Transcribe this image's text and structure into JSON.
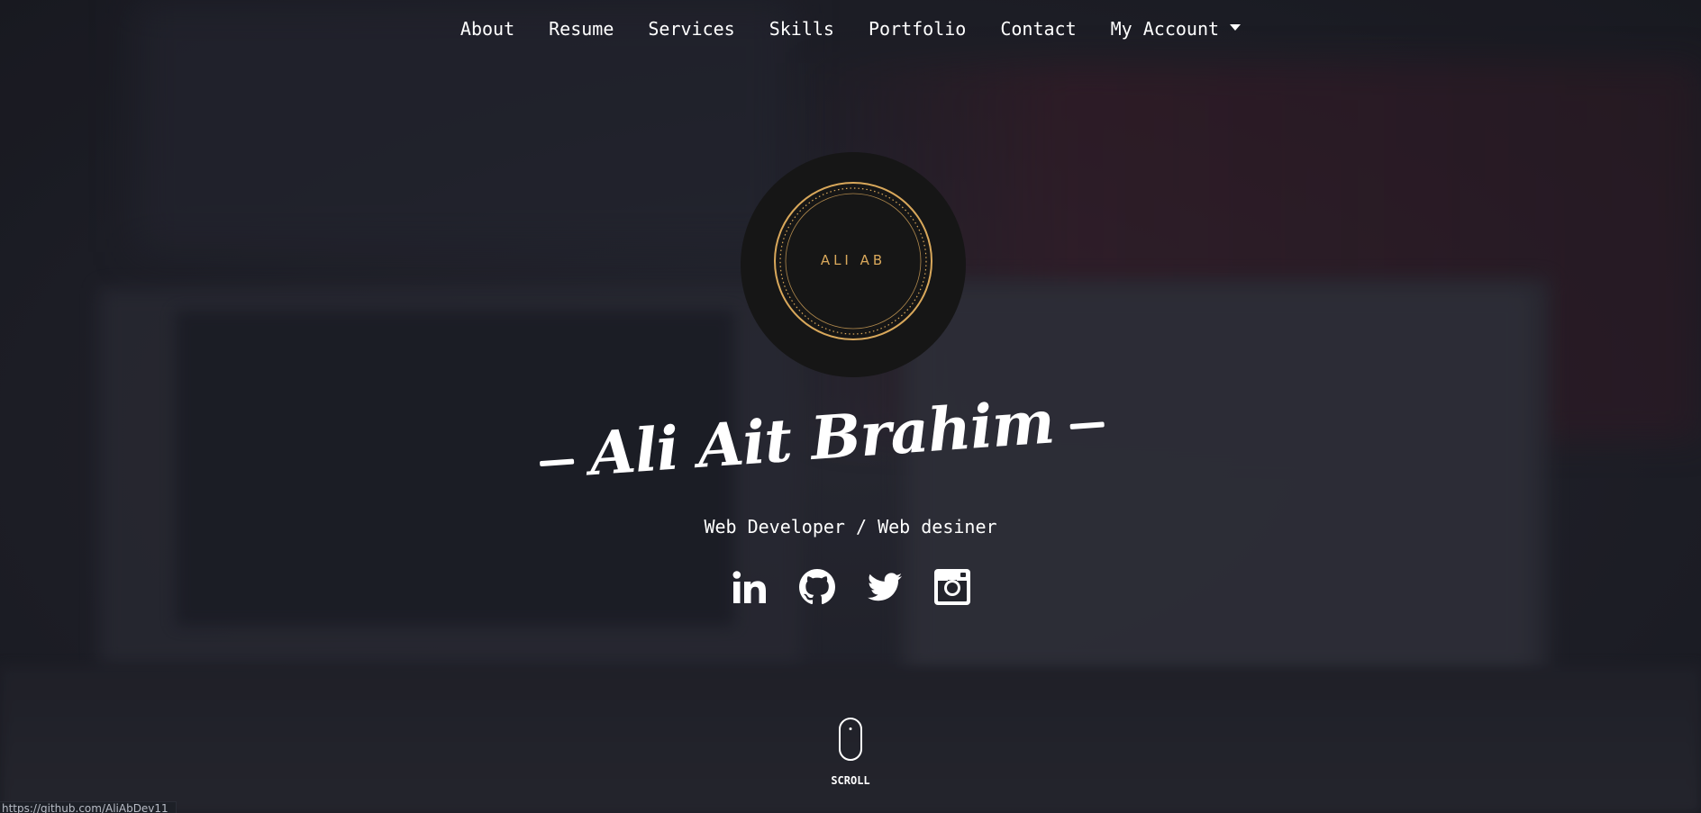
{
  "nav": {
    "items": [
      {
        "label": "About"
      },
      {
        "label": "Resume"
      },
      {
        "label": "Services"
      },
      {
        "label": "Skills"
      },
      {
        "label": "Portfolio"
      },
      {
        "label": "Contact"
      }
    ],
    "account_label": "My Account"
  },
  "logo": {
    "text": "ALI AB",
    "accent_color": "#d9a85b",
    "background_color": "#161616"
  },
  "hero": {
    "name": "Ali Ait Brahim",
    "subtitle": "Web Developer / Web desiner"
  },
  "social": [
    {
      "icon": "linkedin-icon"
    },
    {
      "icon": "github-icon"
    },
    {
      "icon": "twitter-icon"
    },
    {
      "icon": "instagram-icon"
    }
  ],
  "scroll": {
    "label": "SCROLL"
  },
  "status_bar": {
    "url": "https://github.com/AliAbDev11"
  }
}
